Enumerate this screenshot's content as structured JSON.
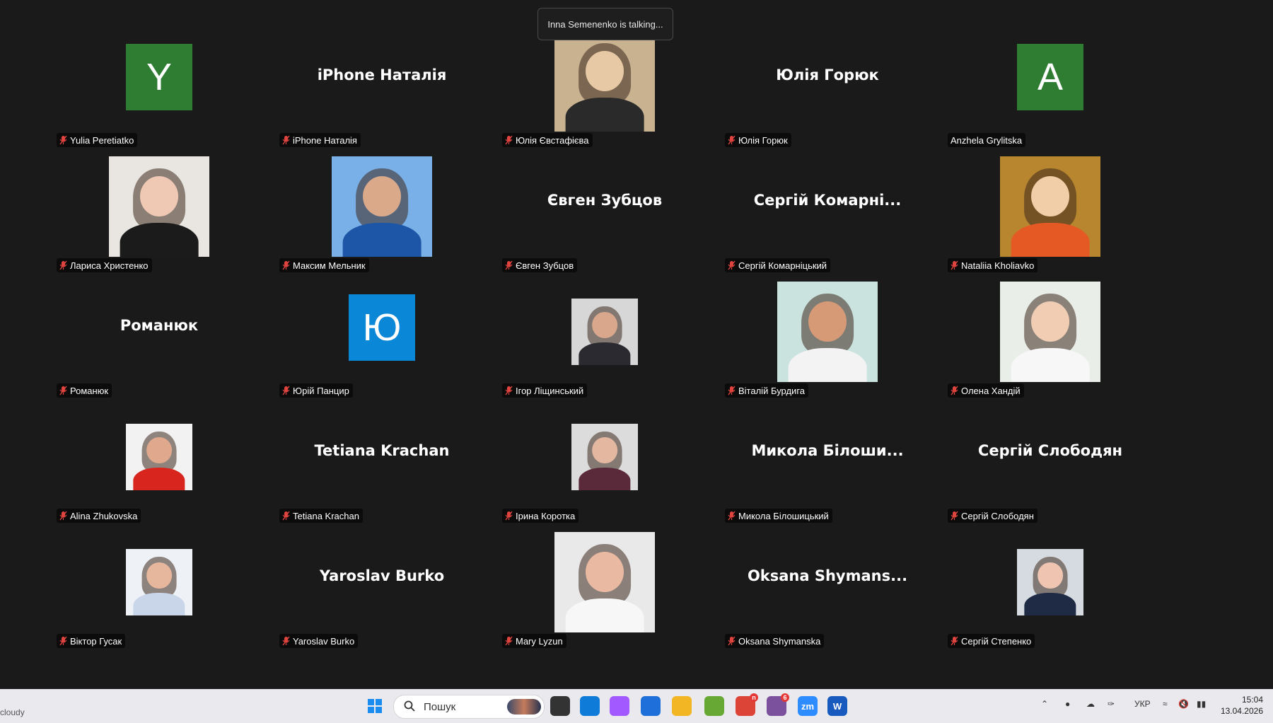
{
  "notice": "Inna Semenenko is talking...",
  "tiles": [
    {
      "label": "Yulia Peretiatko",
      "muted": true,
      "kind": "initial",
      "initial": "Y",
      "bg": "#2e7d32"
    },
    {
      "label": "iPhone Наталія",
      "muted": true,
      "kind": "name",
      "display": "iPhone Наталія"
    },
    {
      "label": "Юлія Євстафієва",
      "muted": true,
      "kind": "photo",
      "tone": [
        "#c8b290",
        "#e7c9a5",
        "#2a2a2a"
      ]
    },
    {
      "label": "Юлія Горюк",
      "muted": true,
      "kind": "name",
      "display": "Юлія Горюк"
    },
    {
      "label": "Anzhela Grylitska",
      "muted": false,
      "kind": "initial",
      "initial": "A",
      "bg": "#2e7d32"
    },
    {
      "label": "Лариса Христенко",
      "muted": true,
      "kind": "photo",
      "tone": [
        "#e9e6e1",
        "#f0c9b5",
        "#1b1b1b"
      ]
    },
    {
      "label": "Максим Мельник",
      "muted": true,
      "kind": "photo",
      "tone": [
        "#7ab0e8",
        "#d9a98a",
        "#1d56a6"
      ]
    },
    {
      "label": "Євген Зубцов",
      "muted": true,
      "kind": "name",
      "display": "Євген Зубцов"
    },
    {
      "label": "Сергій Комарніцький",
      "muted": true,
      "kind": "name",
      "display": "Сергій Комарні..."
    },
    {
      "label": "Nataliia Kholiavko",
      "muted": true,
      "kind": "photo",
      "tone": [
        "#b8862e",
        "#f1cda8",
        "#e55a24"
      ]
    },
    {
      "label": "Романюк",
      "muted": true,
      "kind": "name",
      "display": "Романюк"
    },
    {
      "label": "Юрій Панцир",
      "muted": true,
      "kind": "initial",
      "initial": "Ю",
      "bg": "#0b87d8"
    },
    {
      "label": "Ігор Ліщинський",
      "muted": true,
      "kind": "photo-small",
      "tone": [
        "#d7d7d7",
        "#d9a88c",
        "#2a2a30"
      ]
    },
    {
      "label": "Віталій Бурдига",
      "muted": true,
      "kind": "photo",
      "tone": [
        "#cbe3df",
        "#d69a77",
        "#f3f3f3"
      ]
    },
    {
      "label": "Олена Хандій",
      "muted": true,
      "kind": "photo",
      "tone": [
        "#e9efe8",
        "#f1cdb4",
        "#f7f7f7"
      ]
    },
    {
      "label": "Alina Zhukovska",
      "muted": true,
      "kind": "photo-small",
      "tone": [
        "#f2f2f2",
        "#e0a88d",
        "#d8261f"
      ]
    },
    {
      "label": "Tetiana Krachan",
      "muted": true,
      "kind": "name",
      "display": "Tetiana Krachan"
    },
    {
      "label": "Ірина Коротка",
      "muted": true,
      "kind": "photo-small",
      "tone": [
        "#dcdcdc",
        "#e3b7a0",
        "#5b2a3a"
      ]
    },
    {
      "label": "Микола Білошицький",
      "muted": true,
      "kind": "name",
      "display": "Микола Білоши..."
    },
    {
      "label": "Сергій Слободян",
      "muted": true,
      "kind": "name",
      "display": "Сергій Слободян"
    },
    {
      "label": "Віктор Гусак",
      "muted": true,
      "kind": "photo-small",
      "tone": [
        "#eef2f7",
        "#e7b79d",
        "#c9d6ea"
      ]
    },
    {
      "label": "Yaroslav Burko",
      "muted": true,
      "kind": "name",
      "display": "Yaroslav Burko"
    },
    {
      "label": "Mary Lyzun",
      "muted": true,
      "kind": "photo",
      "tone": [
        "#e9e9e9",
        "#e9b9a2",
        "#f7f7f7"
      ]
    },
    {
      "label": "Oksana Shymanska",
      "muted": true,
      "kind": "name",
      "display": "Oksana Shymans..."
    },
    {
      "label": "Сергій Степенко",
      "muted": true,
      "kind": "photo-small",
      "tone": [
        "#d6dbe1",
        "#efc4b0",
        "#1f2a44"
      ]
    }
  ],
  "taskbar": {
    "weather": "cloudy",
    "search_placeholder": "Пошук",
    "apps": [
      {
        "icon": "task-view-icon",
        "color": "#333"
      },
      {
        "icon": "edge-icon",
        "color": "#0f7bd8"
      },
      {
        "icon": "copilot-icon",
        "color": "#a259ff"
      },
      {
        "icon": "store-icon",
        "color": "#1e6fd9"
      },
      {
        "icon": "file-explorer-icon",
        "color": "#f2b624"
      },
      {
        "icon": "utorrent-icon",
        "color": "#66a833"
      },
      {
        "icon": "chrome-icon",
        "color": "#db4437",
        "badge": "n"
      },
      {
        "icon": "viber-icon",
        "color": "#7b519d",
        "badge": "6"
      },
      {
        "icon": "zoom-icon",
        "color": "#2d8cff",
        "text": "zm"
      },
      {
        "icon": "word-icon",
        "color": "#185abd",
        "text": "W"
      }
    ],
    "language": "УКР",
    "time": "15:04",
    "date": "13.04.2026"
  }
}
